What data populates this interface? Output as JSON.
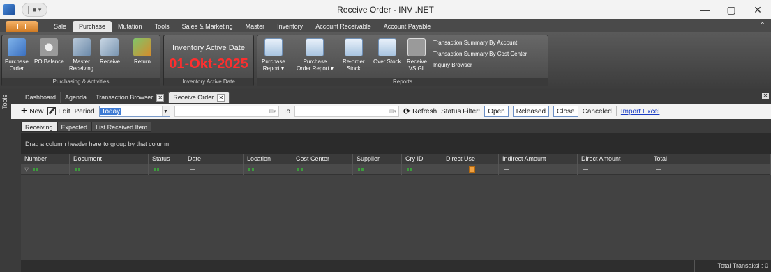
{
  "window": {
    "title": "Receive Order - INV .NET",
    "controls": [
      "—",
      "▢",
      "✕"
    ]
  },
  "ribbon_tabs": [
    "Sale",
    "Purchase",
    "Mutation",
    "Tools",
    "Sales & Marketing",
    "Master",
    "Inventory",
    "Account Receivable",
    "Account Payable"
  ],
  "ribbon": {
    "purchasing": {
      "group_label": "Purchasing & Activities",
      "buttons": [
        {
          "label": "Purchase\nOrder",
          "icon": "purchase-order-icon"
        },
        {
          "label": "PO Balance",
          "icon": "balance-scale-icon"
        },
        {
          "label": "Master\nReceiving",
          "icon": "master-receiving-icon"
        },
        {
          "label": "Receive",
          "icon": "receive-icon"
        },
        {
          "label": "Return",
          "icon": "return-icon"
        }
      ]
    },
    "inventory_date": {
      "title": "Inventory Active Date",
      "value": "01-Okt-2025",
      "group_label": "Inventory Active Date"
    },
    "reports": {
      "group_label": "Reports",
      "buttons": [
        {
          "label": "Purchase\nReport ▾"
        },
        {
          "label": "Purchase\nOrder Report ▾"
        },
        {
          "label": "Re-order\nStock"
        },
        {
          "label": "Over Stock"
        },
        {
          "label": "Receive\nVS GL"
        }
      ],
      "links": [
        "Transaction Summary By Account",
        "Transaction Summary By Cost Center",
        "Inquiry Browser"
      ]
    }
  },
  "side_strip": {
    "label": "Tools"
  },
  "doc_tabs": [
    {
      "label": "Dashboard",
      "closable": false
    },
    {
      "label": "Agenda",
      "closable": false
    },
    {
      "label": "Transaction Browser",
      "closable": true
    },
    {
      "label": "Receive Order",
      "closable": true,
      "active": true
    }
  ],
  "toolbar": {
    "new": "New",
    "edit": "Edit",
    "period_label": "Period",
    "period_value": "Today",
    "to_label": "To",
    "refresh": "Refresh",
    "status_filter_label": "Status Filter:",
    "filters": [
      "Open",
      "Released",
      "Close"
    ],
    "canceled": "Canceled",
    "import_excel": "Import Excel"
  },
  "sub_tabs": [
    "Receiving",
    "Expected",
    "List Received Item"
  ],
  "grid": {
    "group_hint": "Drag a column header here to group by that column",
    "columns": [
      "Number",
      "Document",
      "Status",
      "Date",
      "Location",
      "Cost Center",
      "Supplier",
      "Cry ID",
      "Direct Use",
      "Indirect Amount",
      "Direct Amount",
      "Total"
    ],
    "footer_total": "Total Transaksi : 0"
  }
}
